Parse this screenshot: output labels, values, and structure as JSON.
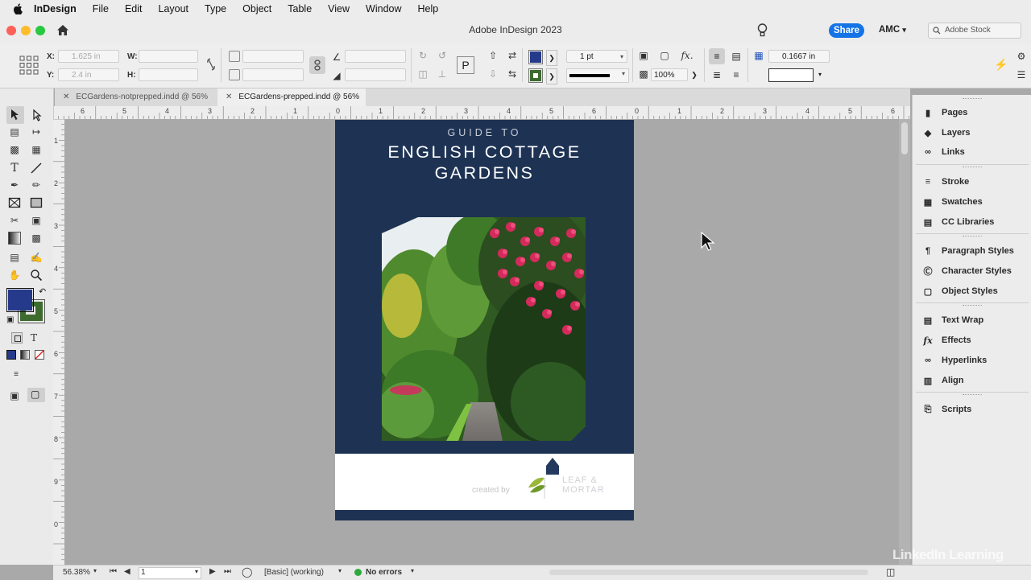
{
  "menu": {
    "app_name": "InDesign",
    "items": [
      "File",
      "Edit",
      "Layout",
      "Type",
      "Object",
      "Table",
      "View",
      "Window",
      "Help"
    ]
  },
  "window": {
    "title": "Adobe InDesign 2023",
    "share_label": "Share",
    "user_initials": "AMC",
    "stock_search_placeholder": "Adobe Stock"
  },
  "control_panel": {
    "x_label": "X:",
    "x_value": "1.625 in",
    "y_label": "Y:",
    "y_value": "2.4 in",
    "w_label": "W:",
    "h_label": "H:",
    "stroke_weight": "1 pt",
    "opacity": "100%",
    "spacing_value": "0.1667 in",
    "fill_color": "#263a8c",
    "stroke_color": "#3d6b2e"
  },
  "tabs": [
    {
      "label": "ECGardens-notprepped.indd @ 56%",
      "active": false
    },
    {
      "label": "ECGardens-prepped.indd @ 56%",
      "active": true
    }
  ],
  "rulers": {
    "h_ticks": [
      "6",
      "5",
      "4",
      "3",
      "2",
      "1",
      "0",
      "1",
      "2",
      "3",
      "4",
      "5",
      "6",
      "0",
      "1",
      "2",
      "3",
      "4",
      "5",
      "6"
    ],
    "v_ticks": [
      "1",
      "2",
      "3",
      "4",
      "5",
      "6",
      "7",
      "8",
      "9",
      "0"
    ]
  },
  "document": {
    "kicker": "GUIDE TO",
    "title_line1": "ENGLISH COTTAGE",
    "title_line2": "GARDENS",
    "created_by": "created by",
    "logo_line1": "LEAF &",
    "logo_line2": "MORTAR",
    "background_color": "#1e3354"
  },
  "panels": [
    {
      "label": "Pages",
      "icon": "pages-icon"
    },
    {
      "label": "Layers",
      "icon": "layers-icon"
    },
    {
      "label": "Links",
      "icon": "links-icon"
    },
    {
      "label": "Stroke",
      "icon": "stroke-icon"
    },
    {
      "label": "Swatches",
      "icon": "swatches-icon"
    },
    {
      "label": "CC Libraries",
      "icon": "cc-libraries-icon"
    },
    {
      "label": "Paragraph Styles",
      "icon": "paragraph-styles-icon"
    },
    {
      "label": "Character Styles",
      "icon": "character-styles-icon"
    },
    {
      "label": "Object Styles",
      "icon": "object-styles-icon"
    },
    {
      "label": "Text Wrap",
      "icon": "text-wrap-icon"
    },
    {
      "label": "Effects",
      "icon": "effects-icon"
    },
    {
      "label": "Hyperlinks",
      "icon": "hyperlinks-icon"
    },
    {
      "label": "Align",
      "icon": "align-icon"
    },
    {
      "label": "Scripts",
      "icon": "scripts-icon"
    }
  ],
  "status": {
    "zoom": "56.38%",
    "page": "1",
    "preflight_profile": "[Basic] (working)",
    "errors": "No errors"
  },
  "watermark": "LinkedIn Learning"
}
